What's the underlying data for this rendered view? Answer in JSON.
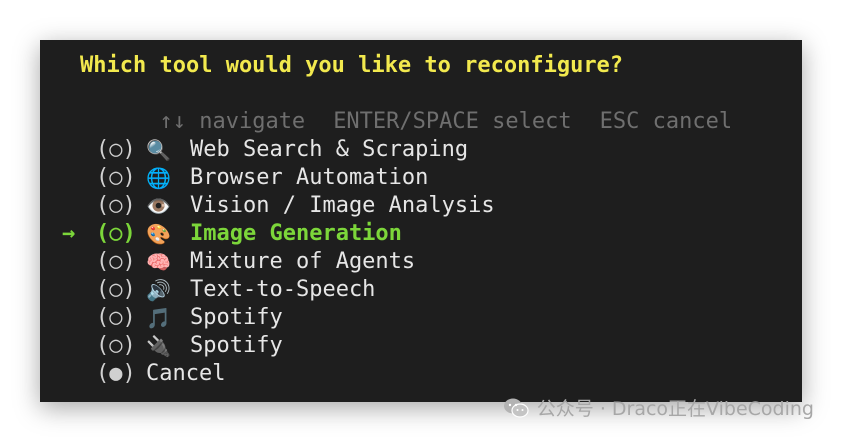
{
  "prompt": {
    "title": "Which tool would you like to reconfigure?",
    "hints": [
      "↑↓ navigate",
      "ENTER/SPACE select",
      "ESC cancel"
    ]
  },
  "options": [
    {
      "radio": "(○)",
      "emoji": "🔍",
      "label": "Web Search & Scraping",
      "selected": false
    },
    {
      "radio": "(○)",
      "emoji": "🌐",
      "label": "Browser Automation",
      "selected": false
    },
    {
      "radio": "(○)",
      "emoji": "👁️",
      "label": "Vision / Image Analysis",
      "selected": false
    },
    {
      "radio": "(○)",
      "emoji": "🎨",
      "label": "Image Generation",
      "selected": true
    },
    {
      "radio": "(○)",
      "emoji": "🧠",
      "label": "Mixture of Agents",
      "selected": false
    },
    {
      "radio": "(○)",
      "emoji": "🔊",
      "label": "Text-to-Speech",
      "selected": false
    },
    {
      "radio": "(○)",
      "emoji": "🎵",
      "label": "Spotify",
      "selected": false
    },
    {
      "radio": "(○)",
      "emoji": "🔌",
      "label": "Spotify",
      "selected": false
    }
  ],
  "cancel": {
    "radio": "(●)",
    "label": "Cancel"
  },
  "pointer_symbol": "→",
  "colors": {
    "terminal_bg": "#1e1e1e",
    "title": "#f2e94e",
    "hint": "#6f6f6f",
    "selected": "#7cd63a",
    "text": "#e6e6e6"
  },
  "watermark": {
    "icon": "wechat-icon",
    "text": "公众号 · Draco正在VibeCoding"
  }
}
